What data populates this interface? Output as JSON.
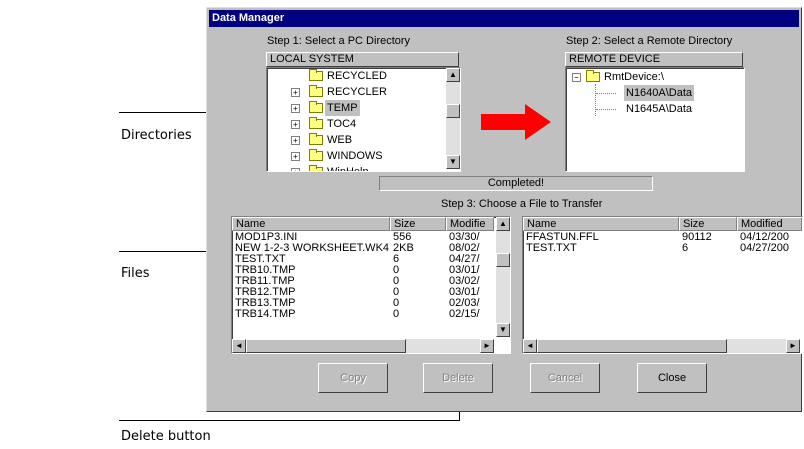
{
  "callouts": {
    "directories": "Directories",
    "files": "Files",
    "delete_button": "Delete button"
  },
  "dialog": {
    "title": "Data Manager",
    "step1": "Step 1: Select a PC Directory",
    "step2": "Step 2: Select a Remote Directory",
    "step3": "Step 3: Choose a File to Transfer",
    "status": "Completed!"
  },
  "local_tree": {
    "header": "LOCAL SYSTEM",
    "items": [
      {
        "label": "RECYCLED",
        "expandable": false,
        "selected": false
      },
      {
        "label": "RECYCLER",
        "expandable": true,
        "selected": false
      },
      {
        "label": "TEMP",
        "expandable": true,
        "selected": true
      },
      {
        "label": "TOC4",
        "expandable": true,
        "selected": false
      },
      {
        "label": "WEB",
        "expandable": true,
        "selected": false
      },
      {
        "label": "WINDOWS",
        "expandable": true,
        "selected": false
      },
      {
        "label": "WinHelp",
        "expandable": true,
        "selected": false
      }
    ]
  },
  "remote_tree": {
    "header": "REMOTE DEVICE",
    "root": "RmtDevice:\\",
    "items": [
      {
        "label": "N1640A\\Data",
        "selected": true
      },
      {
        "label": "N1645A\\Data",
        "selected": false
      }
    ]
  },
  "local_files": {
    "columns": [
      "Name",
      "Size",
      "Modifie"
    ],
    "rows": [
      [
        "MOD1P3.INI",
        "556",
        "03/30/"
      ],
      [
        "NEW 1-2-3 WORKSHEET.WK4",
        "2KB",
        "08/02/"
      ],
      [
        "TEST.TXT",
        "6",
        "04/27/"
      ],
      [
        "TRB10.TMP",
        "0",
        "03/01/"
      ],
      [
        "TRB11.TMP",
        "0",
        "03/02/"
      ],
      [
        "TRB12.TMP",
        "0",
        "03/01/"
      ],
      [
        "TRB13.TMP",
        "0",
        "02/03/"
      ],
      [
        "TRB14.TMP",
        "0",
        "02/15/"
      ]
    ]
  },
  "remote_files": {
    "columns": [
      "Name",
      "Size",
      "Modified"
    ],
    "rows": [
      [
        "FFASTUN.FFL",
        "90112",
        "04/12/200"
      ],
      [
        "TEST.TXT",
        "6",
        "04/27/200"
      ]
    ]
  },
  "buttons": {
    "copy": "Copy",
    "delete": "Delete",
    "cancel": "Cancel",
    "close": "Close"
  },
  "colors": {
    "titlebar": "#000080",
    "arrow": "#ff0000",
    "dialog_bg": "#c0c0c0"
  }
}
